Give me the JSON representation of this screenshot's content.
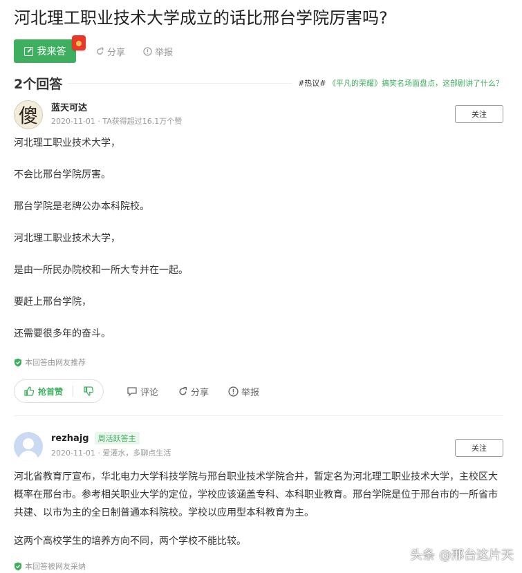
{
  "page": {
    "title": "河北理工职业技术大学成立的话比邢台学院厉害吗?"
  },
  "actions": {
    "answer_label": "我来答",
    "share_label": "分享",
    "report_label": "举报"
  },
  "answers_header": {
    "count_label": "2个回答",
    "hot_tag": "#热议#",
    "hot_link": "《平凡的荣耀》搞笑名场面盘点，这部剧讲了什么？"
  },
  "answers": [
    {
      "avatar_char": "傻",
      "username": "蓝天可达",
      "meta": "2020-11-01 · TA获得超过16.1万个赞",
      "follow_label": "关注",
      "paragraphs": [
        "河北理工职业技术大学，",
        "不会比邢台学院厉害。",
        "邢台学院是老牌公办本科院校。",
        "河北理工职业技术大学，",
        "是由一所民办院校和一所大专并在一起。",
        "要赶上邢台学院，",
        "还需要很多年的奋斗。"
      ],
      "recommend": "本回答由网友推荐",
      "vote_label": "抢首赞",
      "comment_label": "评论",
      "share_label": "分享",
      "report_label": "举报"
    },
    {
      "username": "rezhajg",
      "badge": "周活跃答主",
      "meta": "2020-11-01 · 爱灌水，多聊点生活",
      "follow_label": "关注",
      "paragraphs": [
        "河北省教育厅宣布，华北电力大学科技学院与邢台职业技术学院合并，暂定名为河北理工职业技术大学，主校区大概率在邢台市。参考相关职业大学的定位，学校应该涵盖专科、本科职业教育。邢台学院是位于邢台市的一所省市共建、以市为主的全日制普通本科院校。学校以应用型本科教育为主。",
        "这两个高校学生的培养方向不同，两个学校不能比较。"
      ],
      "recommend": "本回答被网友采纳"
    }
  ],
  "watermark": "头条 @邢台这片天",
  "colors": {
    "accent": "#3eaf5e",
    "red_packet": "#e8372b"
  }
}
